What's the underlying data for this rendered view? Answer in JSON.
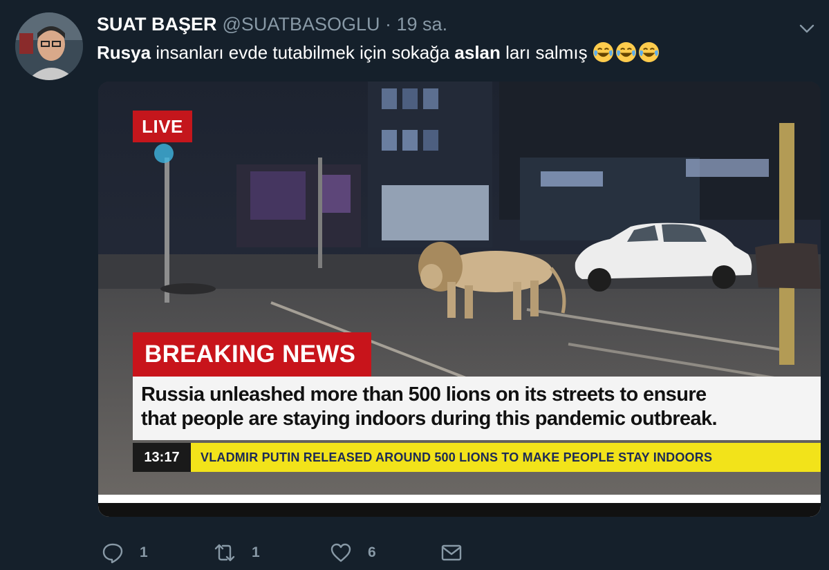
{
  "author": {
    "name": "SUAT BAŞER",
    "handle": "@SUATBASOGLU",
    "separator": "·",
    "time": "19 sa."
  },
  "tweet": {
    "text_part1": "Rusya",
    "text_part2": " insanları evde tutabilmek için sokağa ",
    "text_part3": "aslan",
    "text_part4": " ları salmış ",
    "emoji": [
      "face-with-tears-of-joy-icon",
      "face-with-tears-of-joy-icon",
      "face-with-tears-of-joy-icon"
    ]
  },
  "media": {
    "live_label": "LIVE",
    "breaking_label": "BREAKING NEWS",
    "headline_line1": "Russia unleashed more than 500 lions on its streets to ensure",
    "headline_line2": "that people are staying indoors during this pandemic outbreak.",
    "clock": "13:17",
    "ticker": "VLADMIR PUTIN RELEASED AROUND 500 LIONS TO MAKE PEOPLE STAY INDOORS"
  },
  "actions": {
    "reply_count": "1",
    "retweet_count": "1",
    "like_count": "6"
  },
  "colors": {
    "background": "#15202b",
    "secondary_text": "#8899a6",
    "news_red": "#c8141b",
    "ticker_yellow": "#f2e31a"
  }
}
